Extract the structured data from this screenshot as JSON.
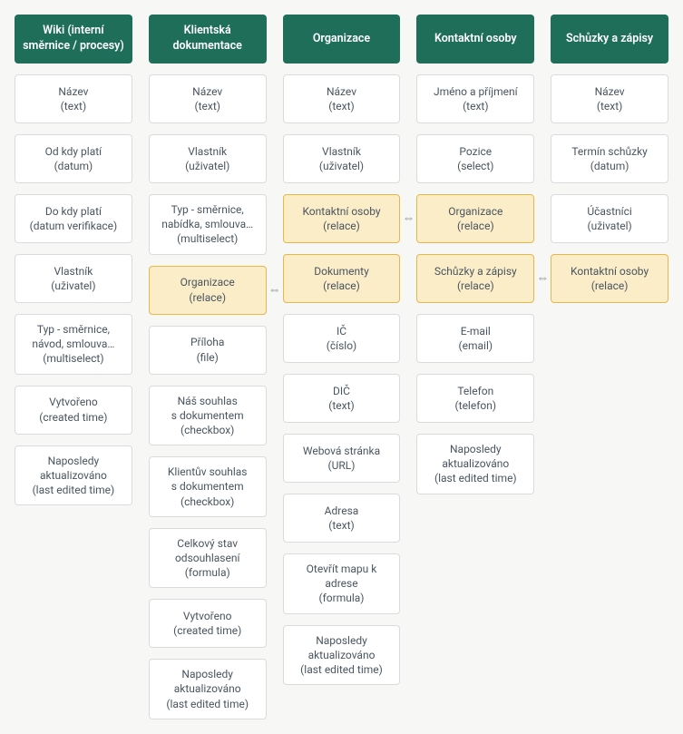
{
  "columns": [
    {
      "header": "Wiki (interní směrnice / procesy)",
      "cells": [
        {
          "l1": "Název",
          "l2": "(text)"
        },
        {
          "l1": "Od kdy platí",
          "l2": "(datum)"
        },
        {
          "l1": "Do kdy platí",
          "l2": "(datum verifikace)"
        },
        {
          "l1": "Vlastník",
          "l2": "(uživatel)"
        },
        {
          "l1": "Typ - směrnice,",
          "l2": "návod, smlouva…",
          "l3": "(multiselect)"
        },
        {
          "l1": "Vytvořeno",
          "l2": "(created time)"
        },
        {
          "l1": "Naposledy",
          "l2": "aktualizováno",
          "l3": "(last edited time)"
        }
      ]
    },
    {
      "header": "Klientská dokumentace",
      "cells": [
        {
          "l1": "Název",
          "l2": "(text)"
        },
        {
          "l1": "Vlastník",
          "l2": "(uživatel)"
        },
        {
          "l1": "Typ - směrnice,",
          "l2": "nabídka, smlouva…",
          "l3": "(multiselect)"
        },
        {
          "l1": "Organizace",
          "l2": "(relace)",
          "rel": true,
          "arrow": true
        },
        {
          "l1": "Příloha",
          "l2": "(file)"
        },
        {
          "l1": "Náš souhlas",
          "l2": "s dokumentem",
          "l3": "(checkbox)"
        },
        {
          "l1": "Klientův souhlas",
          "l2": "s dokumentem",
          "l3": "(checkbox)"
        },
        {
          "l1": "Celkový stav",
          "l2": "odsouhlasení",
          "l3": "(formula)"
        },
        {
          "l1": "Vytvořeno",
          "l2": "(created time)"
        },
        {
          "l1": "Naposledy",
          "l2": "aktualizováno",
          "l3": "(last edited time)"
        }
      ]
    },
    {
      "header": "Organizace",
      "cells": [
        {
          "l1": "Název",
          "l2": "(text)"
        },
        {
          "l1": "Vlastník",
          "l2": "(uživatel)"
        },
        {
          "l1": "Kontaktní osoby",
          "l2": "(relace)",
          "rel": true,
          "arrow": true
        },
        {
          "l1": "Dokumenty",
          "l2": "(relace)",
          "rel": true
        },
        {
          "l1": "IČ",
          "l2": "(číslo)"
        },
        {
          "l1": "DIČ",
          "l2": "(text)"
        },
        {
          "l1": "Webová stránka",
          "l2": "(URL)"
        },
        {
          "l1": "Adresa",
          "l2": "(text)"
        },
        {
          "l1": "Otevřít mapu k",
          "l2": "adrese",
          "l3": "(formula)"
        },
        {
          "l1": "Naposledy",
          "l2": "aktualizováno",
          "l3": "(last edited time)"
        }
      ]
    },
    {
      "header": "Kontaktní osoby",
      "cells": [
        {
          "l1": "Jméno a příjmení",
          "l2": "(text)"
        },
        {
          "l1": "Pozice",
          "l2": "(select)"
        },
        {
          "l1": "Organizace",
          "l2": "(relace)",
          "rel": true
        },
        {
          "l1": "Schůzky a zápisy",
          "l2": "(relace)",
          "rel": true,
          "arrow": true
        },
        {
          "l1": "E-mail",
          "l2": "(email)"
        },
        {
          "l1": "Telefon",
          "l2": "(telefon)"
        },
        {
          "l1": "Naposledy",
          "l2": "aktualizováno",
          "l3": "(last edited time)"
        }
      ]
    },
    {
      "header": "Schůzky a zápisy",
      "cells": [
        {
          "l1": "Název",
          "l2": "(text)"
        },
        {
          "l1": "Termín schůzky",
          "l2": "(datum)"
        },
        {
          "l1": "Účastníci",
          "l2": "(uživatel)"
        },
        {
          "l1": "Kontaktní osoby",
          "l2": "(relace)",
          "rel": true
        }
      ]
    }
  ]
}
